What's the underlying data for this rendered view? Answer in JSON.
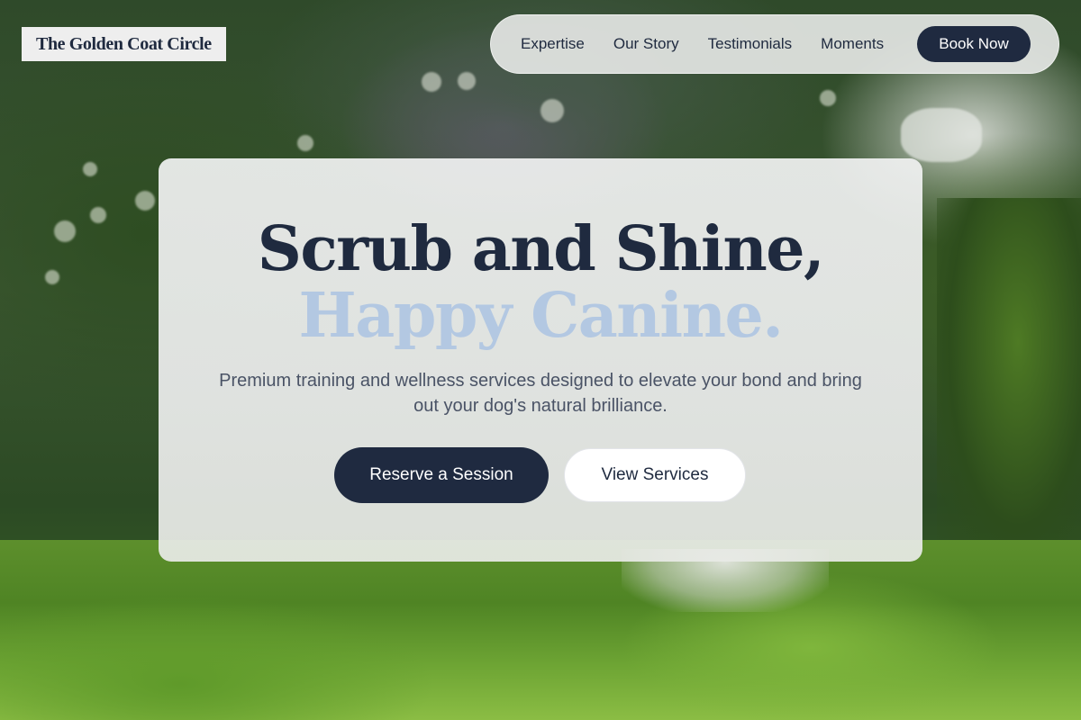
{
  "brand": {
    "name": "The Golden Coat Circle"
  },
  "nav": {
    "links": [
      "Expertise",
      "Our Story",
      "Testimonials",
      "Moments"
    ],
    "cta_label": "Book Now"
  },
  "hero": {
    "title_line1": "Scrub and Shine,",
    "title_line2": "Happy Canine.",
    "subtitle": "Premium training and wellness services designed to elevate your bond and bring out your dog's natural brilliance.",
    "primary_label": "Reserve a Session",
    "secondary_label": "View Services"
  },
  "colors": {
    "navy": "#1f2a40",
    "accent_blue": "#b3c8e2",
    "card": "#eeefef",
    "body_text": "#4a5366"
  }
}
